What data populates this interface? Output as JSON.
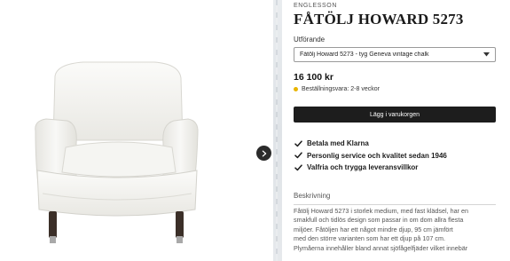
{
  "product": {
    "brand": "ENGLESSON",
    "title": "FÅTÖLJ HOWARD 5273",
    "variant_label": "Utförande",
    "variant_selected": "Fåtölj Howard 5273 - tyg Geneva vintage chalk",
    "price": "16 100 kr",
    "stock_status": "Beställningsvara: 2-8 veckor",
    "stock_color": "#e8b400",
    "cart_button_label": "Lägg i varukorgen"
  },
  "usps": [
    {
      "icon": "checkmark-icon",
      "label": "Betala med Klarna"
    },
    {
      "icon": "checkmark-icon",
      "label": "Personlig service och kvalitet sedan 1946"
    },
    {
      "icon": "checkmark-icon",
      "label": "Valfria och trygga leveransvillkor"
    }
  ],
  "description": {
    "heading": "Beskrivning",
    "lines": [
      "Fåtölj Howard 5273 i storlek medium, med fast klädsel, har en",
      "smakfull och tidlös design som passar in om dom allra flesta",
      "miljöer. Fåtöljen har ett något mindre djup, 95 cm jämfört",
      "med den större varianten som har ett djup på 107 cm.",
      "Plymåerna innehåller bland annat sjöfågelfjäder vilket innebär"
    ]
  },
  "gallery": {
    "next_icon": "chevron-right-icon",
    "image_alt": "armchair-image"
  },
  "colors": {
    "button_bg": "#1d1d1d",
    "arrow_bg": "#2b2b2b"
  }
}
